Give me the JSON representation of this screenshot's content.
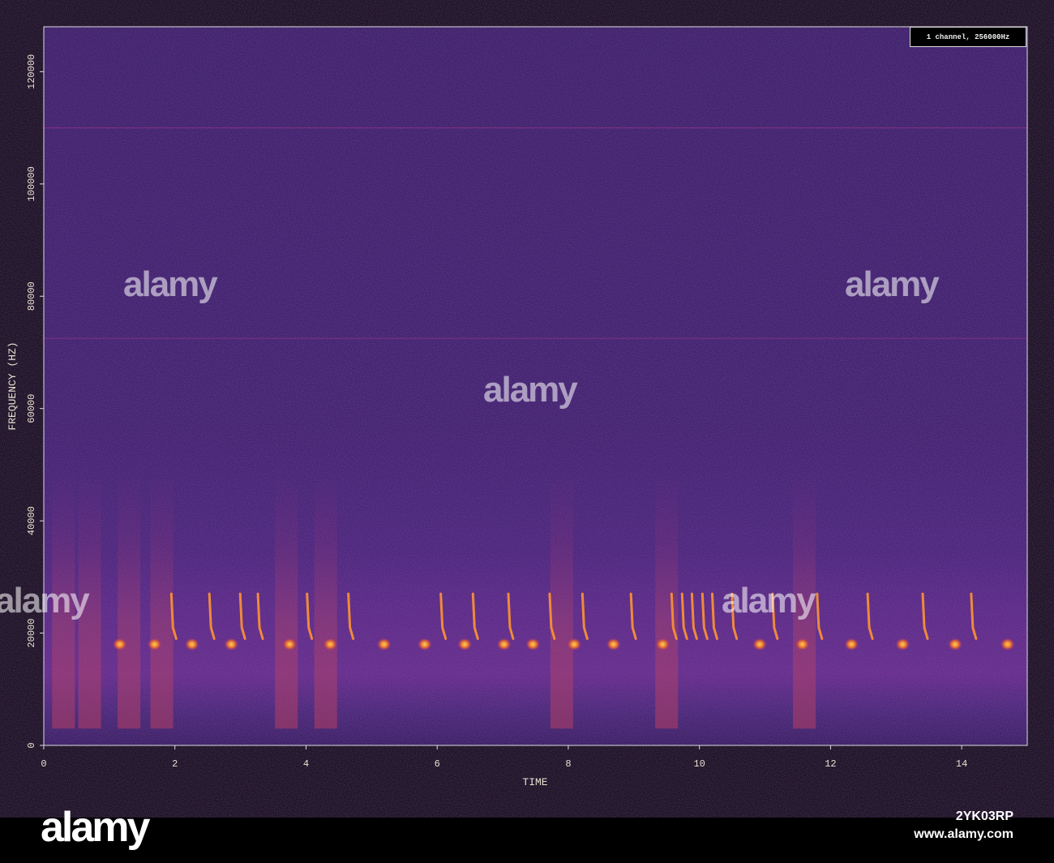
{
  "chart_data": {
    "type": "heatmap",
    "title": "",
    "xlabel": "TIME",
    "ylabel": "FREQUENCY (HZ)",
    "xlim": [
      0,
      15
    ],
    "ylim": [
      0,
      128000
    ],
    "xticks": [
      0,
      2,
      4,
      6,
      8,
      10,
      12,
      14
    ],
    "yticks": [
      0,
      20000,
      40000,
      60000,
      80000,
      100000,
      120000
    ],
    "legend": "1 channel, 256000Hz",
    "legend_position": "top-right",
    "colormap": [
      "#1a0a3a",
      "#3a1a6a",
      "#8a2a8a",
      "#d8502a",
      "#f8b040"
    ],
    "noise_line_hz": [
      72500,
      110000
    ],
    "low_calls": {
      "freq_hz": 18000,
      "times": [
        1.16,
        1.69,
        2.26,
        2.86,
        3.75,
        4.37,
        5.19,
        5.81,
        6.42,
        7.02,
        7.46,
        8.09,
        8.69,
        9.44,
        10.92,
        11.57,
        12.32,
        13.1,
        13.9,
        14.7
      ]
    },
    "sweep_calls": {
      "freq_top_hz": 27000,
      "freq_bottom_hz": 19000,
      "times": [
        1.97,
        2.55,
        3.02,
        3.29,
        4.04,
        4.67,
        6.08,
        6.57,
        7.11,
        7.74,
        8.24,
        8.98,
        9.6,
        9.76,
        9.91,
        10.07,
        10.22,
        10.52,
        11.14,
        11.82,
        12.59,
        13.43,
        14.17
      ]
    },
    "broadband_bursts": [
      0.3,
      0.7,
      1.3,
      1.8,
      3.7,
      4.3,
      7.9,
      9.5,
      11.6
    ]
  },
  "watermark": {
    "brand": "alamy",
    "image_id": "2YK03RP",
    "url": "www.alamy.com"
  }
}
